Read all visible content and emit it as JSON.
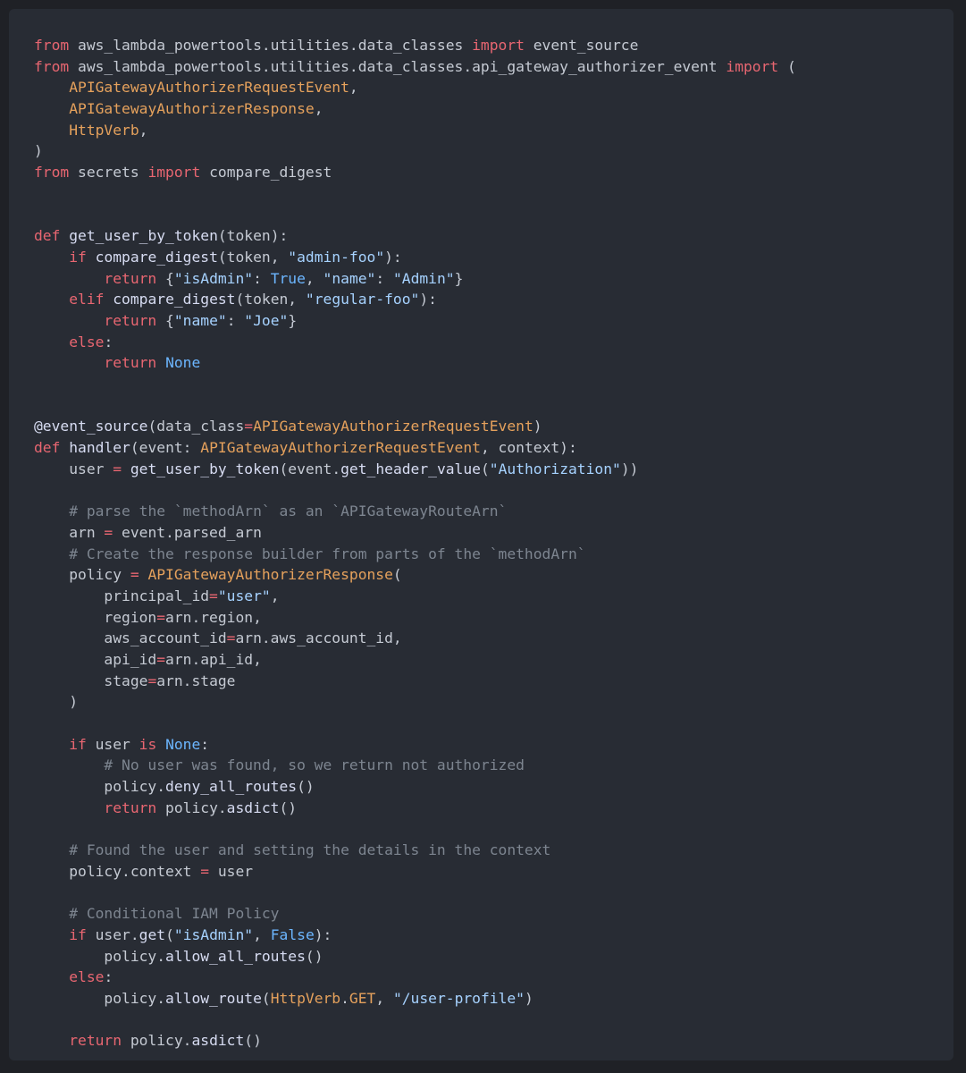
{
  "theme": {
    "background": "#282c34",
    "outer_background": "#1f2126",
    "colors": {
      "keyword": "#e86671",
      "class": "#e5a15c",
      "function": "#d7dcf2",
      "string": "#a6d2ff",
      "constant": "#6cb6ff",
      "comment": "#7d8590",
      "identifier": "#c5cad3"
    }
  },
  "code": {
    "language": "python",
    "lines": [
      [
        [
          "kw",
          "from"
        ],
        [
          "id",
          " aws_lambda_powertools.utilities.data_classes "
        ],
        [
          "kw",
          "import"
        ],
        [
          "id",
          " event_source"
        ]
      ],
      [
        [
          "kw",
          "from"
        ],
        [
          "id",
          " aws_lambda_powertools.utilities.data_classes.api_gateway_authorizer_event "
        ],
        [
          "kw",
          "import"
        ],
        [
          "id",
          " ("
        ]
      ],
      [
        [
          "id",
          "    "
        ],
        [
          "cls",
          "APIGatewayAuthorizerRequestEvent"
        ],
        [
          "id",
          ","
        ]
      ],
      [
        [
          "id",
          "    "
        ],
        [
          "cls",
          "APIGatewayAuthorizerResponse"
        ],
        [
          "id",
          ","
        ]
      ],
      [
        [
          "id",
          "    "
        ],
        [
          "cls",
          "HttpVerb"
        ],
        [
          "id",
          ","
        ]
      ],
      [
        [
          "id",
          ")"
        ]
      ],
      [
        [
          "kw",
          "from"
        ],
        [
          "id",
          " secrets "
        ],
        [
          "kw",
          "import"
        ],
        [
          "id",
          " compare_digest"
        ]
      ],
      [],
      [],
      [
        [
          "kw",
          "def"
        ],
        [
          "id",
          " "
        ],
        [
          "fn",
          "get_user_by_token"
        ],
        [
          "id",
          "(token):"
        ]
      ],
      [
        [
          "id",
          "    "
        ],
        [
          "kw",
          "if"
        ],
        [
          "id",
          " "
        ],
        [
          "fn",
          "compare_digest"
        ],
        [
          "id",
          "(token, "
        ],
        [
          "str",
          "\"admin-foo\""
        ],
        [
          "id",
          "):"
        ]
      ],
      [
        [
          "id",
          "        "
        ],
        [
          "kw",
          "return"
        ],
        [
          "id",
          " {"
        ],
        [
          "str",
          "\"isAdmin\""
        ],
        [
          "id",
          ": "
        ],
        [
          "const",
          "True"
        ],
        [
          "id",
          ", "
        ],
        [
          "str",
          "\"name\""
        ],
        [
          "id",
          ": "
        ],
        [
          "str",
          "\"Admin\""
        ],
        [
          "id",
          "}"
        ]
      ],
      [
        [
          "id",
          "    "
        ],
        [
          "kw",
          "elif"
        ],
        [
          "id",
          " "
        ],
        [
          "fn",
          "compare_digest"
        ],
        [
          "id",
          "(token, "
        ],
        [
          "str",
          "\"regular-foo\""
        ],
        [
          "id",
          "):"
        ]
      ],
      [
        [
          "id",
          "        "
        ],
        [
          "kw",
          "return"
        ],
        [
          "id",
          " {"
        ],
        [
          "str",
          "\"name\""
        ],
        [
          "id",
          ": "
        ],
        [
          "str",
          "\"Joe\""
        ],
        [
          "id",
          "}"
        ]
      ],
      [
        [
          "id",
          "    "
        ],
        [
          "kw",
          "else"
        ],
        [
          "id",
          ":"
        ]
      ],
      [
        [
          "id",
          "        "
        ],
        [
          "kw",
          "return"
        ],
        [
          "id",
          " "
        ],
        [
          "const",
          "None"
        ]
      ],
      [],
      [],
      [
        [
          "fn",
          "@event_source"
        ],
        [
          "id",
          "(data_class"
        ],
        [
          "kw",
          "="
        ],
        [
          "cls",
          "APIGatewayAuthorizerRequestEvent"
        ],
        [
          "id",
          ")"
        ]
      ],
      [
        [
          "kw",
          "def"
        ],
        [
          "id",
          " "
        ],
        [
          "fn",
          "handler"
        ],
        [
          "id",
          "(event: "
        ],
        [
          "cls",
          "APIGatewayAuthorizerRequestEvent"
        ],
        [
          "id",
          ", context):"
        ]
      ],
      [
        [
          "id",
          "    user "
        ],
        [
          "kw",
          "="
        ],
        [
          "id",
          " "
        ],
        [
          "fn",
          "get_user_by_token"
        ],
        [
          "id",
          "(event."
        ],
        [
          "fn",
          "get_header_value"
        ],
        [
          "id",
          "("
        ],
        [
          "str",
          "\"Authorization\""
        ],
        [
          "id",
          "))"
        ]
      ],
      [],
      [
        [
          "id",
          "    "
        ],
        [
          "cm",
          "# parse the `methodArn` as an `APIGatewayRouteArn`"
        ]
      ],
      [
        [
          "id",
          "    arn "
        ],
        [
          "kw",
          "="
        ],
        [
          "id",
          " event.parsed_arn"
        ]
      ],
      [
        [
          "id",
          "    "
        ],
        [
          "cm",
          "# Create the response builder from parts of the `methodArn`"
        ]
      ],
      [
        [
          "id",
          "    policy "
        ],
        [
          "kw",
          "="
        ],
        [
          "id",
          " "
        ],
        [
          "cls",
          "APIGatewayAuthorizerResponse"
        ],
        [
          "id",
          "("
        ]
      ],
      [
        [
          "id",
          "        principal_id"
        ],
        [
          "kw",
          "="
        ],
        [
          "str",
          "\"user\""
        ],
        [
          "id",
          ","
        ]
      ],
      [
        [
          "id",
          "        region"
        ],
        [
          "kw",
          "="
        ],
        [
          "id",
          "arn.region,"
        ]
      ],
      [
        [
          "id",
          "        aws_account_id"
        ],
        [
          "kw",
          "="
        ],
        [
          "id",
          "arn.aws_account_id,"
        ]
      ],
      [
        [
          "id",
          "        api_id"
        ],
        [
          "kw",
          "="
        ],
        [
          "id",
          "arn.api_id,"
        ]
      ],
      [
        [
          "id",
          "        stage"
        ],
        [
          "kw",
          "="
        ],
        [
          "id",
          "arn.stage"
        ]
      ],
      [
        [
          "id",
          "    )"
        ]
      ],
      [],
      [
        [
          "id",
          "    "
        ],
        [
          "kw",
          "if"
        ],
        [
          "id",
          " user "
        ],
        [
          "kw",
          "is"
        ],
        [
          "id",
          " "
        ],
        [
          "const",
          "None"
        ],
        [
          "id",
          ":"
        ]
      ],
      [
        [
          "id",
          "        "
        ],
        [
          "cm",
          "# No user was found, so we return not authorized"
        ]
      ],
      [
        [
          "id",
          "        policy."
        ],
        [
          "fn",
          "deny_all_routes"
        ],
        [
          "id",
          "()"
        ]
      ],
      [
        [
          "id",
          "        "
        ],
        [
          "kw",
          "return"
        ],
        [
          "id",
          " policy."
        ],
        [
          "fn",
          "asdict"
        ],
        [
          "id",
          "()"
        ]
      ],
      [],
      [
        [
          "id",
          "    "
        ],
        [
          "cm",
          "# Found the user and setting the details in the context"
        ]
      ],
      [
        [
          "id",
          "    policy.context "
        ],
        [
          "kw",
          "="
        ],
        [
          "id",
          " user"
        ]
      ],
      [],
      [
        [
          "id",
          "    "
        ],
        [
          "cm",
          "# Conditional IAM Policy"
        ]
      ],
      [
        [
          "id",
          "    "
        ],
        [
          "kw",
          "if"
        ],
        [
          "id",
          " user."
        ],
        [
          "fn",
          "get"
        ],
        [
          "id",
          "("
        ],
        [
          "str",
          "\"isAdmin\""
        ],
        [
          "id",
          ", "
        ],
        [
          "const",
          "False"
        ],
        [
          "id",
          "):"
        ]
      ],
      [
        [
          "id",
          "        policy."
        ],
        [
          "fn",
          "allow_all_routes"
        ],
        [
          "id",
          "()"
        ]
      ],
      [
        [
          "id",
          "    "
        ],
        [
          "kw",
          "else"
        ],
        [
          "id",
          ":"
        ]
      ],
      [
        [
          "id",
          "        policy."
        ],
        [
          "fn",
          "allow_route"
        ],
        [
          "id",
          "("
        ],
        [
          "cls",
          "HttpVerb"
        ],
        [
          "id",
          "."
        ],
        [
          "cls",
          "GET"
        ],
        [
          "id",
          ", "
        ],
        [
          "str",
          "\"/user-profile\""
        ],
        [
          "id",
          ")"
        ]
      ],
      [],
      [
        [
          "id",
          "    "
        ],
        [
          "kw",
          "return"
        ],
        [
          "id",
          " policy."
        ],
        [
          "fn",
          "asdict"
        ],
        [
          "id",
          "()"
        ]
      ]
    ]
  }
}
